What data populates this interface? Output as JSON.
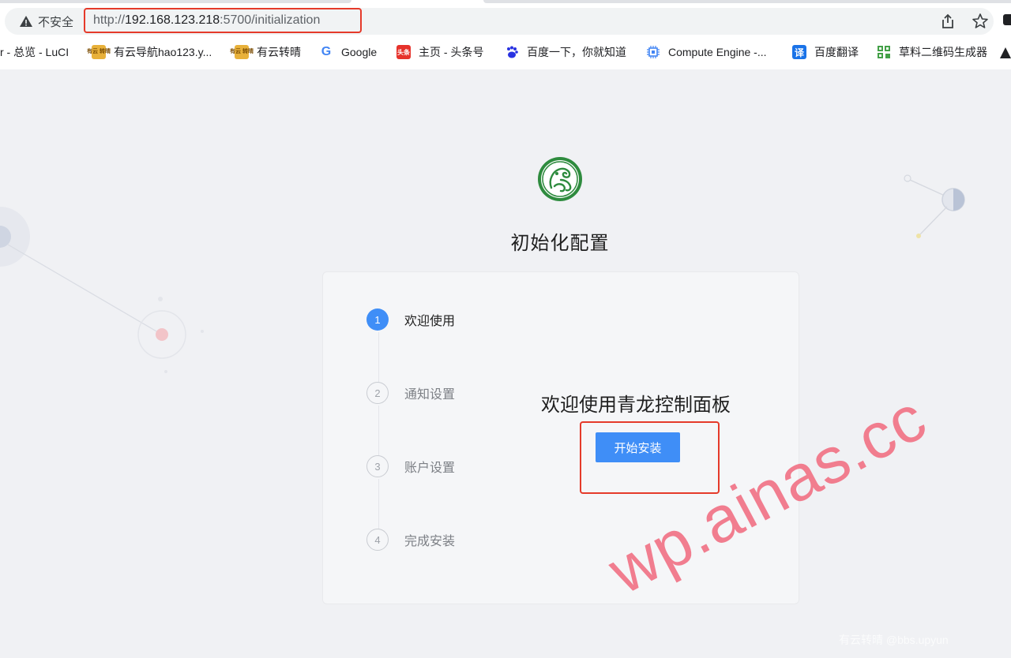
{
  "browser": {
    "security_label": "不安全",
    "url_scheme": "http://",
    "url_host": "192.168.123.218",
    "url_rest": ":5700/initialization",
    "bookmarks": [
      {
        "label": "r - 总览 - LuCI",
        "icon": "none"
      },
      {
        "label": "有云导航hao123.y...",
        "icon": "youyun-icon"
      },
      {
        "label": "有云转晴",
        "icon": "youyun-icon"
      },
      {
        "label": "Google",
        "icon": "google-icon"
      },
      {
        "label": "主页 - 头条号",
        "icon": "toutiao-icon"
      },
      {
        "label": "百度一下，你就知道",
        "icon": "baidu-icon"
      },
      {
        "label": "Compute Engine -...",
        "icon": "compute-engine-icon"
      },
      {
        "label": "百度翻译",
        "icon": "translate-icon"
      },
      {
        "label": "草料二维码生成器",
        "icon": "qrcode-icon"
      }
    ],
    "favicon_text": {
      "youyun": "有云\n转晴",
      "toutiao": "头条",
      "translate": "译"
    }
  },
  "page": {
    "title": "初始化配置",
    "steps": [
      {
        "number": "1",
        "label": "欢迎使用",
        "state": "active"
      },
      {
        "number": "2",
        "label": "通知设置",
        "state": "wait"
      },
      {
        "number": "3",
        "label": "账户设置",
        "state": "wait"
      },
      {
        "number": "4",
        "label": "完成安装",
        "state": "wait"
      }
    ],
    "welcome_text": "欢迎使用青龙控制面板",
    "start_button": "开始安装"
  },
  "watermark": {
    "large": "wp.ainas.cc",
    "small": "有云转晴 @bbs.upyun"
  },
  "colors": {
    "primary": "#3f8ef7",
    "highlight": "#e53a2a",
    "watermark": "#f06c80",
    "logo_green": "#2e8b3e"
  }
}
